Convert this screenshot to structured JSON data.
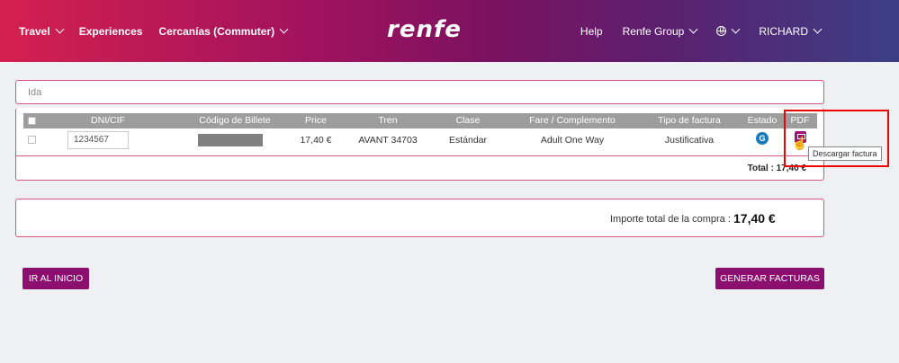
{
  "header": {
    "nav_left": [
      "Travel",
      "Experiences",
      "Cercanías (Commuter)"
    ],
    "logo": "renfe",
    "nav_right": {
      "help": "Help",
      "group": "Renfe Group",
      "user": "RICHARD"
    }
  },
  "ida_label": "Ida",
  "table": {
    "columns": [
      "DNI/CIF",
      "Código de Billete",
      "Price",
      "Tren",
      "Clase",
      "Fare / Complemento",
      "Tipo de factura",
      "Estado",
      "PDF"
    ],
    "row": {
      "dni": "1234567",
      "price": "17,40 €",
      "tren": "AVANT 34703",
      "clase": "Estándar",
      "fare": "Adult One Way",
      "tipo": "Justificativa",
      "estado_icon": "G"
    },
    "tooltip": "Descargar factura",
    "total": "Total : 17,40 €"
  },
  "summary": {
    "label": "Importe total de la compra :",
    "value": "17,40 €"
  },
  "buttons": {
    "home": "IR AL INICIO",
    "generate": "GENERAR FACTURAS"
  },
  "colors": {
    "accent": "#8a0f6f",
    "panel_border": "#d9577a",
    "highlight": "#ee0000"
  }
}
